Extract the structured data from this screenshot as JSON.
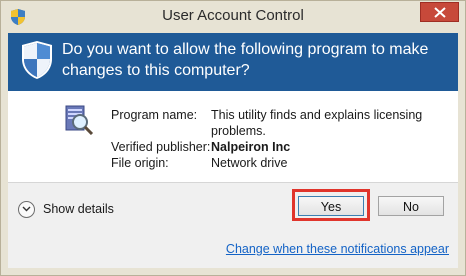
{
  "window": {
    "title": "User Account Control"
  },
  "banner": {
    "question": "Do you want to allow the following program to make changes to this computer?"
  },
  "details": {
    "program_name_label": "Program name:",
    "program_name_value": "This utility finds and explains licensing problems.",
    "publisher_label": "Verified publisher:",
    "publisher_value": "Nalpeiron Inc",
    "origin_label": "File origin:",
    "origin_value": "Network drive"
  },
  "footer": {
    "show_details_label": "Show details",
    "yes_label": "Yes",
    "no_label": "No",
    "notifications_link": "Change when these notifications appear"
  },
  "colors": {
    "banner_blue": "#1f5a97",
    "frame": "#e7e3d4",
    "close_red": "#c7493a",
    "highlight_red": "#e0352c",
    "link_blue": "#1463c6"
  },
  "icons": [
    "uac-shield-icon",
    "close-icon",
    "program-icon",
    "chevron-down-icon"
  ]
}
